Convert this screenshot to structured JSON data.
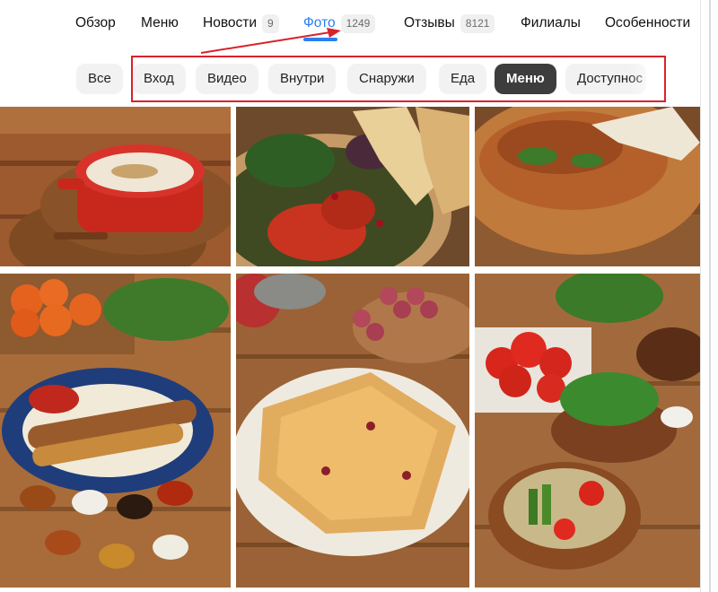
{
  "tabs": [
    {
      "label": "Обзор"
    },
    {
      "label": "Меню"
    },
    {
      "label": "Новости",
      "count": "9"
    },
    {
      "label": "Фото",
      "count": "1249",
      "active": true
    },
    {
      "label": "Отзывы",
      "count": "8121"
    },
    {
      "label": "Филиалы"
    },
    {
      "label": "Особенности"
    }
  ],
  "chips": [
    {
      "label": "Все"
    },
    {
      "label": "Вход"
    },
    {
      "label": "Видео"
    },
    {
      "label": "Внутри"
    },
    {
      "label": "Снаружи"
    },
    {
      "label": "Еда"
    },
    {
      "label": "Меню",
      "active": true
    },
    {
      "label": "Доступнос"
    }
  ],
  "colors": {
    "accent": "#2a7ff0",
    "annotation": "#d9222a",
    "chip_active": "#3d3d3d",
    "chip_bg": "#f2f2f2"
  },
  "photos": [
    {
      "name": "photo-soup-pot"
    },
    {
      "name": "photo-salad-bread"
    },
    {
      "name": "photo-khachapuri"
    },
    {
      "name": "photo-kebab-platter"
    },
    {
      "name": "photo-pastry"
    },
    {
      "name": "photo-vegetables"
    }
  ]
}
